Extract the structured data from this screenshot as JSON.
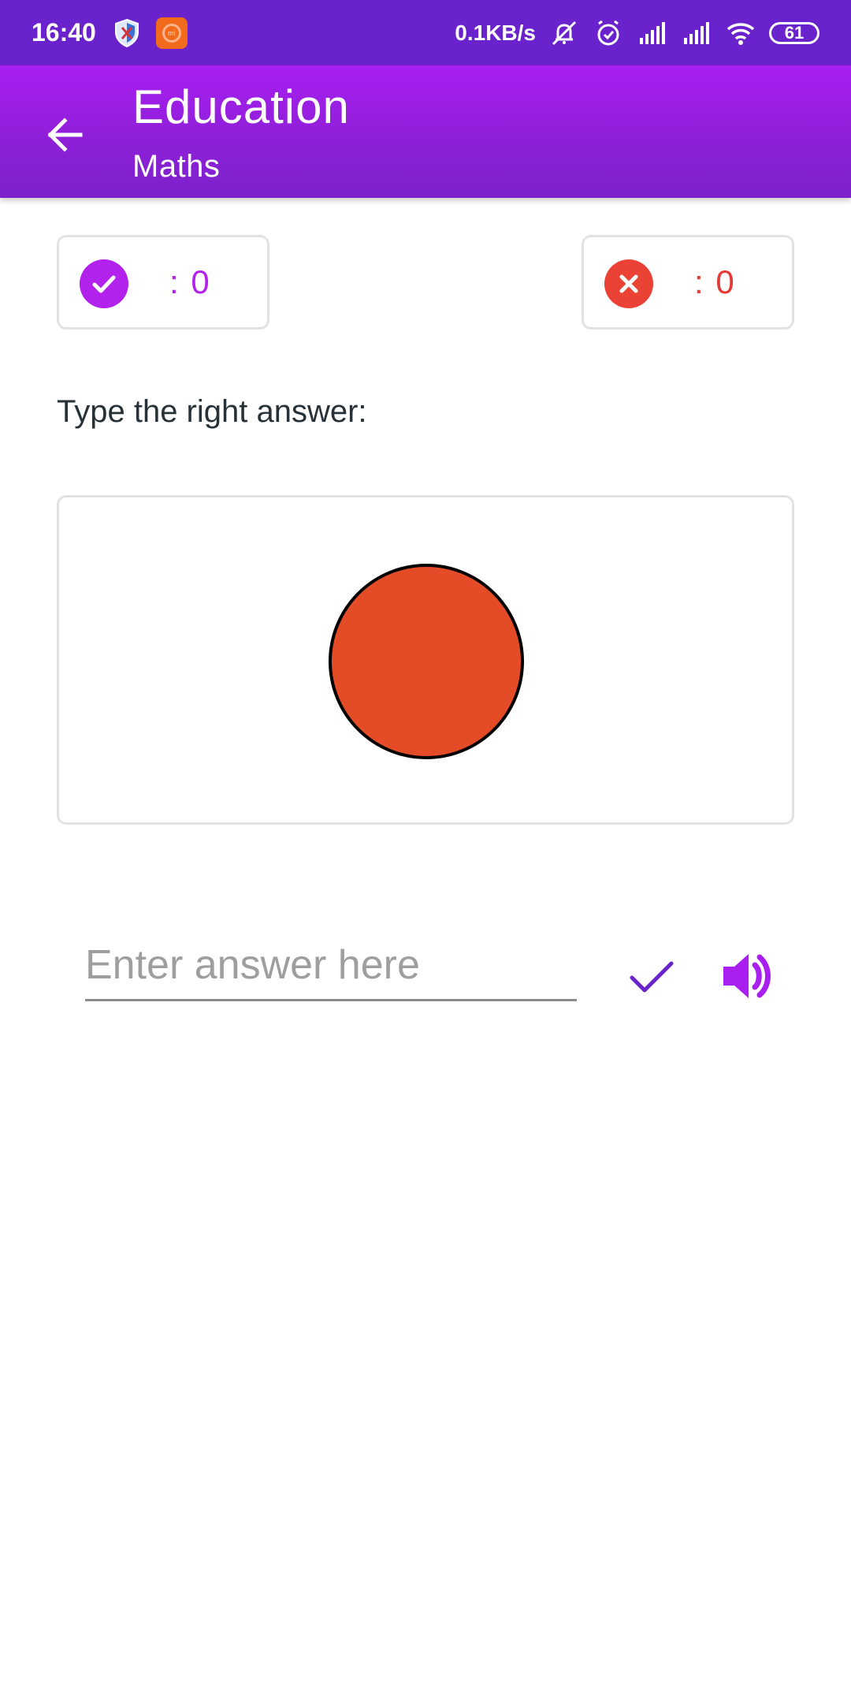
{
  "status_bar": {
    "time": "16:40",
    "network_speed": "0.1KB/s",
    "battery_level": "61",
    "icons": [
      "shield-app-icon",
      "mi-app-icon",
      "mute-icon",
      "alarm-icon",
      "signal-icon",
      "signal-icon",
      "wifi-icon",
      "battery-icon"
    ]
  },
  "app_bar": {
    "title": "Education",
    "subtitle": "Maths",
    "back_icon": "arrow-left-icon"
  },
  "score": {
    "correct_label": ": 0",
    "wrong_label": ": 0",
    "correct_color": "#b322ec",
    "wrong_color": "#ea4335"
  },
  "question": {
    "prompt": "Type the right answer:",
    "shape": "circle",
    "shape_fill": "#e44b27",
    "shape_stroke": "#000000"
  },
  "answer": {
    "value": "",
    "placeholder": "Enter answer here",
    "submit_icon": "check-icon",
    "audio_icon": "speaker-icon"
  },
  "colors": {
    "accent": "#a81ff0",
    "status_bar": "#6a22cc"
  }
}
